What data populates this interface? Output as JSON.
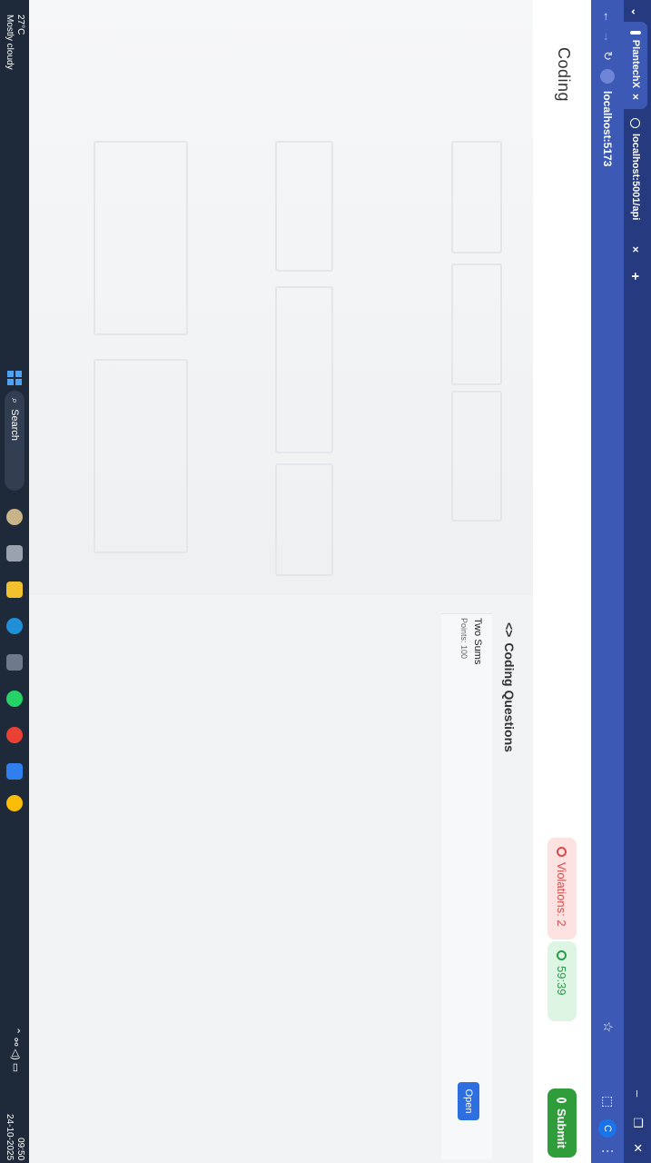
{
  "browser": {
    "tabs": [
      {
        "title": "PlantechX",
        "active": true
      },
      {
        "title": "localhost:5001/api",
        "active": false
      }
    ],
    "new_tab": "+",
    "url": "localhost:5173",
    "profile_initial": "C"
  },
  "app": {
    "brand": "Coding",
    "violations": "Violations: 2",
    "timer": "59:39",
    "submit": "Submit"
  },
  "questions": {
    "heading_icon": "<>",
    "heading": "Coding Questions",
    "items": [
      {
        "name": "Two Sums",
        "points": "Points: 100",
        "action": "Open"
      }
    ]
  },
  "taskbar": {
    "weather_temp": "27°C",
    "weather_desc": "Mostly cloudy",
    "search": "Search",
    "time": "09:50",
    "date": "24-10-2025"
  },
  "colors": {
    "tab_bar": "#263a80",
    "address_bar": "#3c59b5",
    "violations_bg": "#fde2e2",
    "timer_bg": "#dff5e3",
    "submit_bg": "#2f9d3a",
    "open_bg": "#2d6fe0"
  }
}
